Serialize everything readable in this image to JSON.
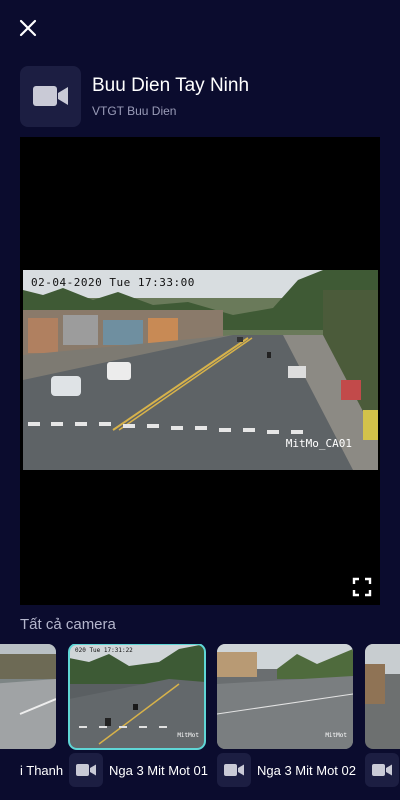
{
  "header": {
    "title": "Buu Dien Tay Ninh",
    "subtitle": "VTGT Buu Dien"
  },
  "player": {
    "osd_text": "02-04-2020 Tue 17:33:00",
    "watermark": "MitMo_CA01"
  },
  "section_title": "Tất cả camera",
  "cameras": [
    {
      "name": "i Thanh",
      "selected": false
    },
    {
      "name": "Nga 3 Mit Mot 01",
      "selected": true,
      "osd_text": "020 Tue 17:31:22",
      "watermark": "MitMot"
    },
    {
      "name": "Nga 3 Mit Mot 02",
      "selected": false,
      "watermark": "MitMot"
    }
  ],
  "icons": {
    "close": "close-icon",
    "camera": "video-camera-icon",
    "fullscreen": "fullscreen-icon"
  },
  "colors": {
    "background": "#0b0c2e",
    "tile": "#1c1e42",
    "selected_border": "#5fd6d6"
  }
}
